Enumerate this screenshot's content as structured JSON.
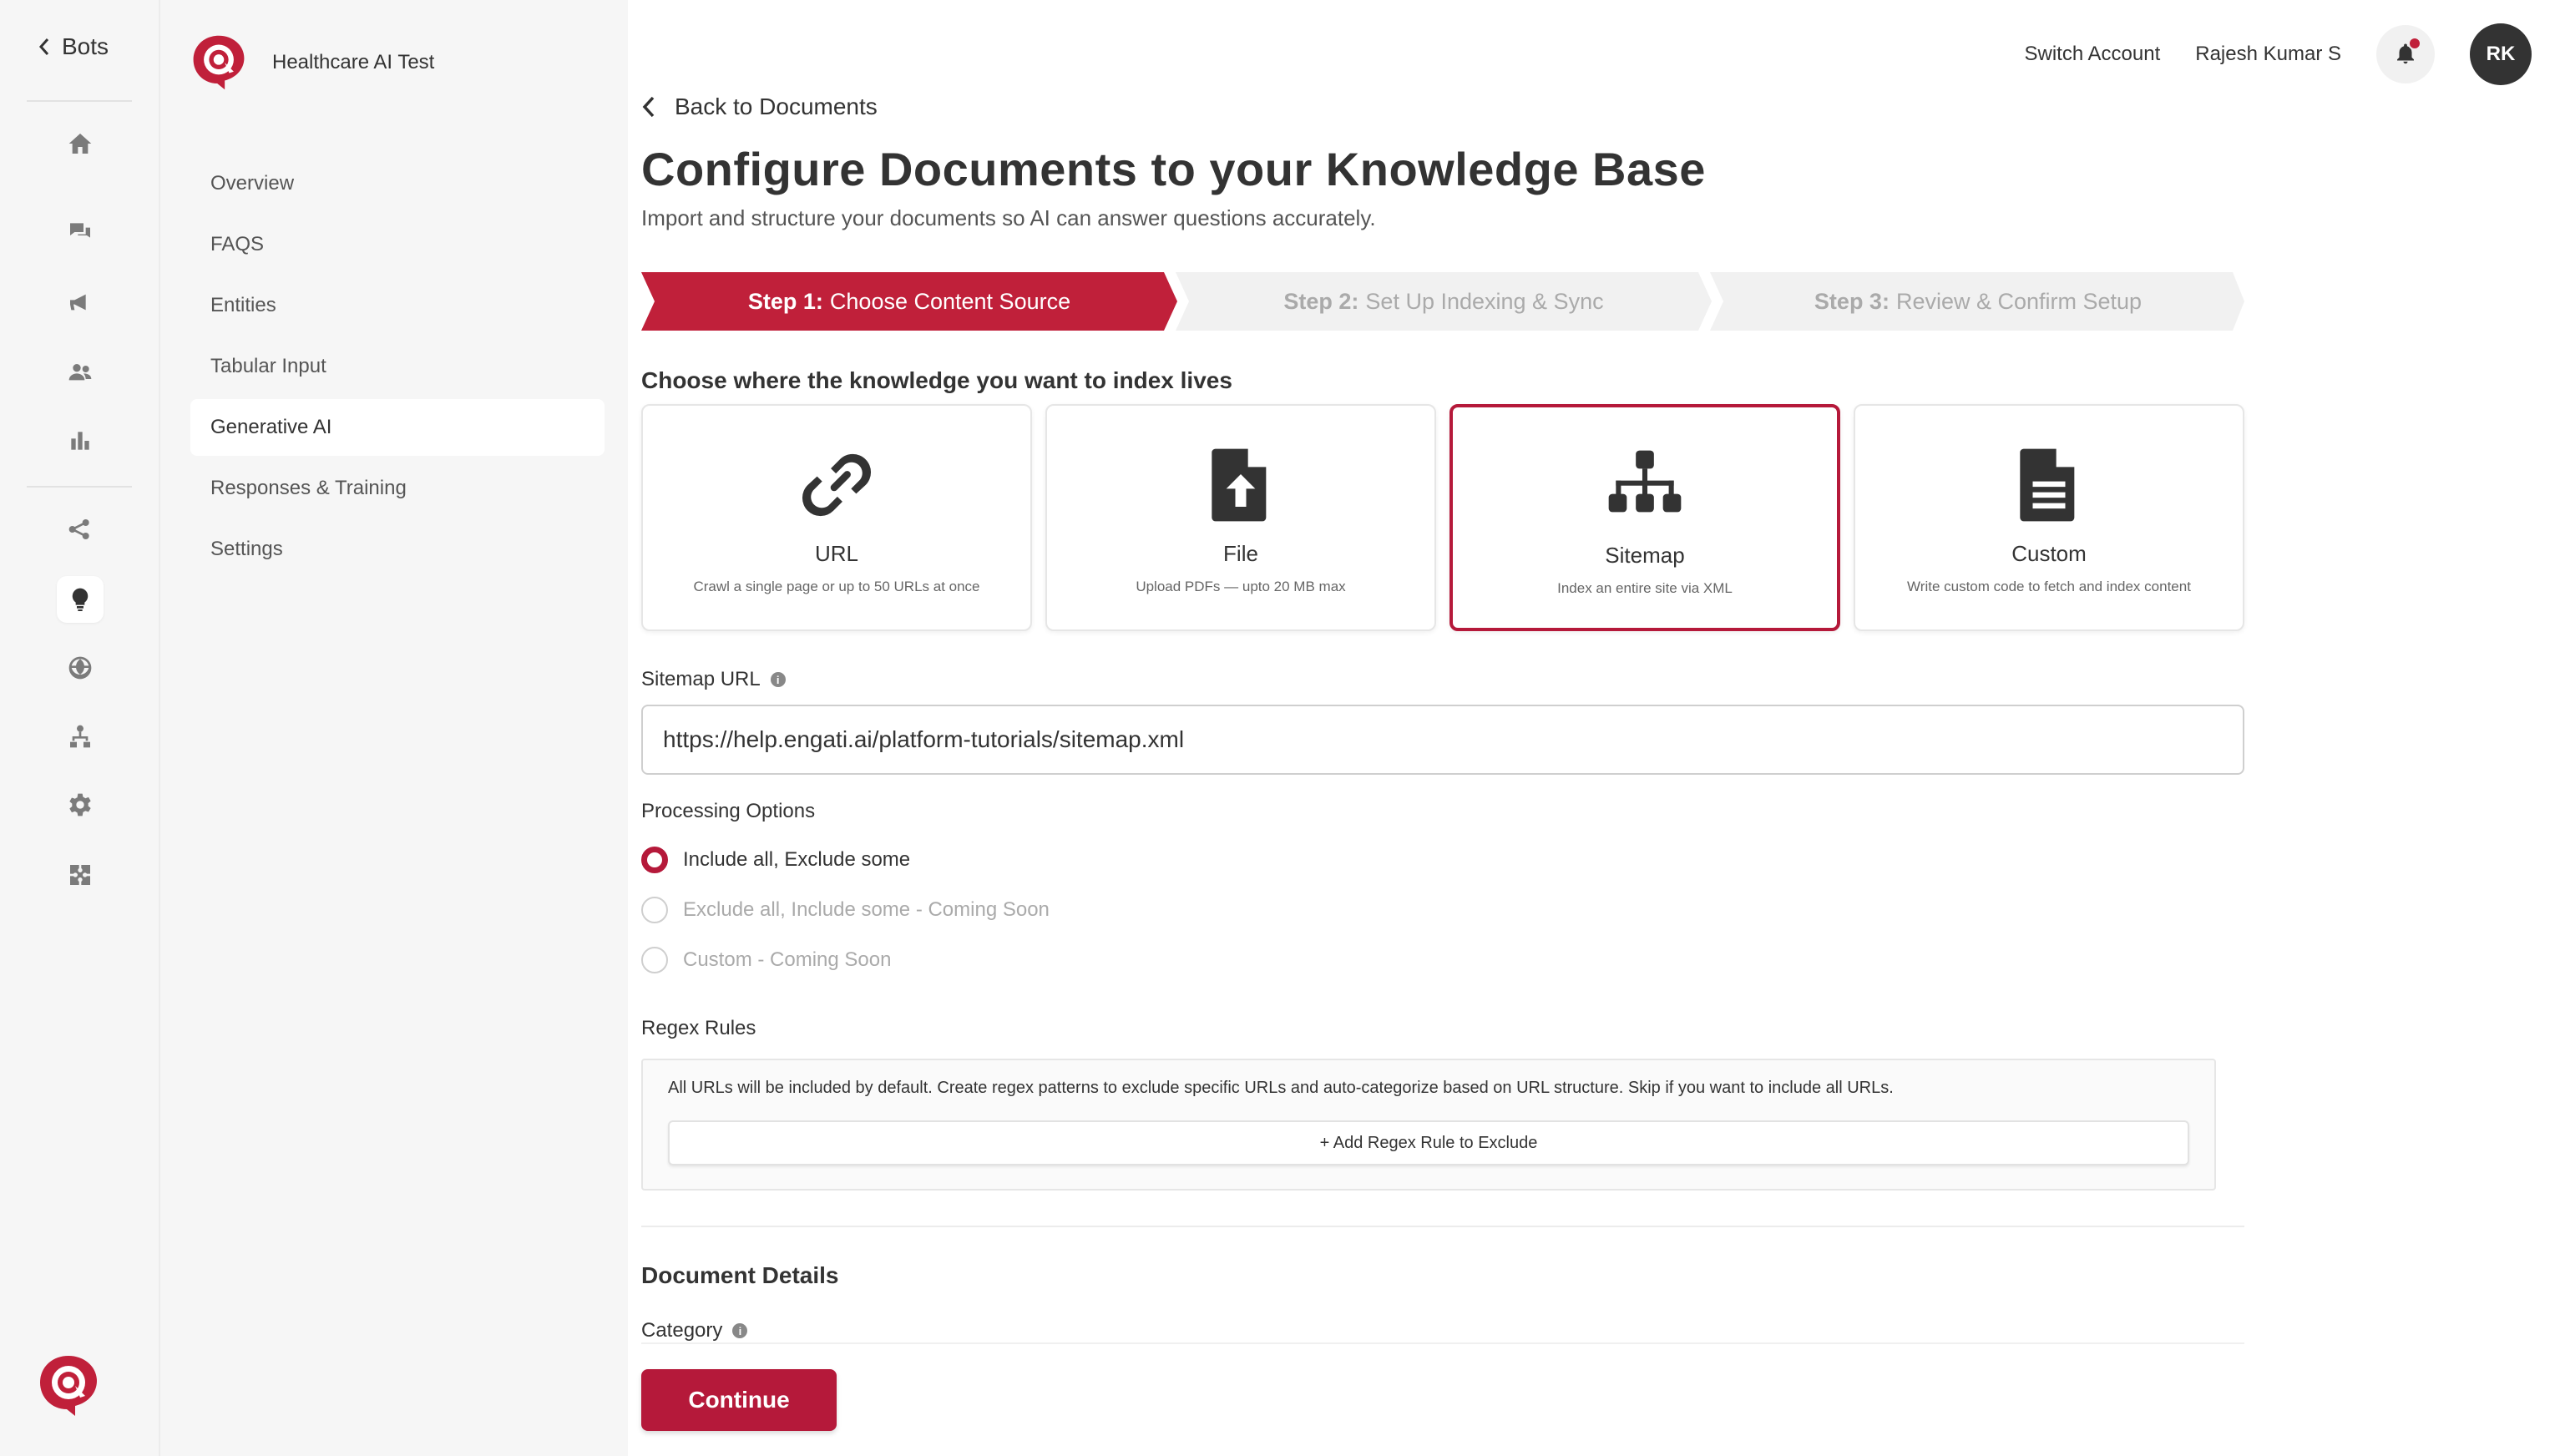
{
  "rail": {
    "back_label": "Bots",
    "icons": [
      "home-icon",
      "chat-icon",
      "megaphone-icon",
      "users-icon",
      "bar-chart-icon",
      "flow-icon",
      "lightbulb-icon",
      "globe-icon",
      "tree-icon",
      "gear-icon",
      "puzzle-icon"
    ],
    "active_icon": "lightbulb-icon"
  },
  "subnav": {
    "bot_name": "Healthcare AI Test",
    "items": [
      "Overview",
      "FAQS",
      "Entities",
      "Tabular Input",
      "Generative AI",
      "Responses & Training",
      "Settings"
    ],
    "active": "Generative AI"
  },
  "topbar": {
    "switch_account": "Switch Account",
    "user_name": "Rajesh Kumar S",
    "avatar_initials": "RK"
  },
  "main": {
    "back_label": "Back to Documents",
    "title": "Configure Documents to your Knowledge Base",
    "subtitle": "Import and structure your documents so AI can answer questions accurately.",
    "steps": [
      {
        "prefix": "Step 1:",
        "label": "Choose Content Source",
        "state": "active"
      },
      {
        "prefix": "Step 2:",
        "label": "Set Up Indexing & Sync",
        "state": "inactive"
      },
      {
        "prefix": "Step 3:",
        "label": "Review & Confirm Setup",
        "state": "inactive"
      }
    ],
    "source_heading": "Choose where the knowledge you want to index lives",
    "sources": [
      {
        "title": "URL",
        "desc": "Crawl a single page or up to 50 URLs at once",
        "icon": "link-icon"
      },
      {
        "title": "File",
        "desc": "Upload PDFs — upto 20 MB max",
        "icon": "file-upload-icon"
      },
      {
        "title": "Sitemap",
        "desc": "Index an entire site via XML",
        "icon": "sitemap-icon"
      },
      {
        "title": "Custom",
        "desc": "Write custom code to fetch and index content",
        "icon": "document-icon"
      }
    ],
    "selected_source": "Sitemap",
    "sitemap_label": "Sitemap URL",
    "sitemap_value": "https://help.engati.ai/platform-tutorials/sitemap.xml",
    "processing_label": "Processing Options",
    "processing_options": [
      {
        "label": "Include all, Exclude some",
        "checked": true,
        "disabled": false
      },
      {
        "label": "Exclude all, Include some - Coming Soon",
        "checked": false,
        "disabled": true
      },
      {
        "label": "Custom - Coming Soon",
        "checked": false,
        "disabled": true
      }
    ],
    "regex_label": "Regex Rules",
    "regex_description": "All URLs will be included by default. Create regex patterns to exclude specific URLs and auto-categorize based on URL structure. Skip if you want to include all URLs.",
    "regex_button": "+ Add Regex Rule to Exclude",
    "document_details": "Document Details",
    "category_label": "Category",
    "continue_label": "Continue"
  },
  "colors": {
    "accent": "#b5193a",
    "step_active": "#c0203a",
    "step_inactive": "#f1f1f1"
  }
}
